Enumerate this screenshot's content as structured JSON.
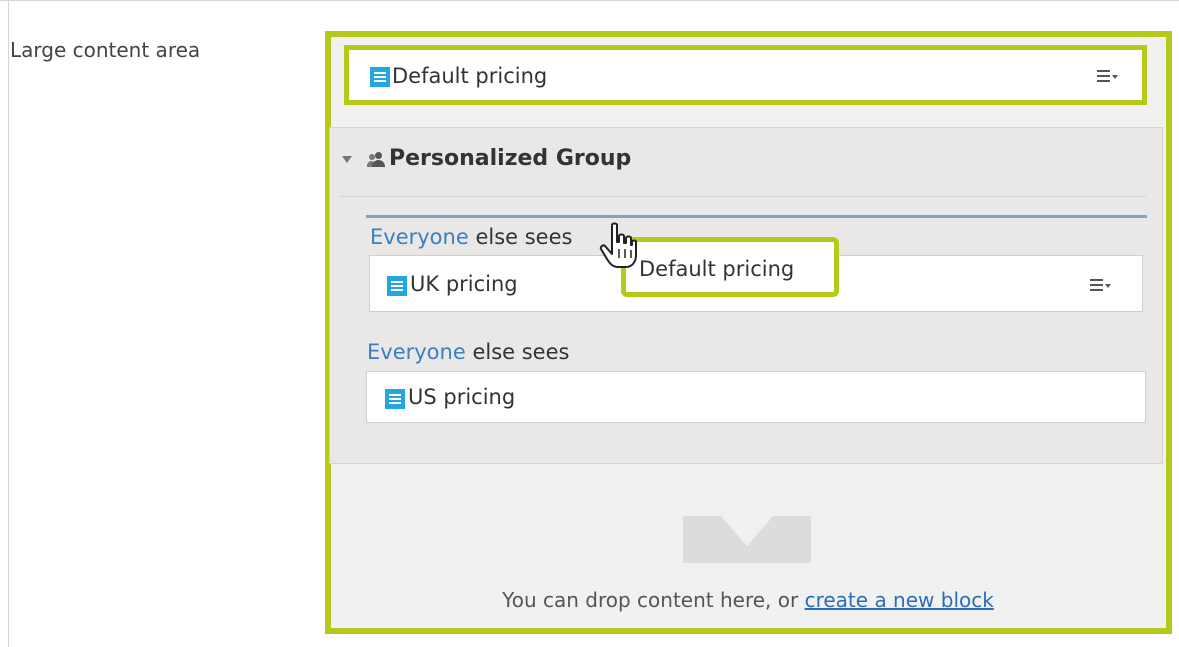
{
  "area": {
    "label": "Large content area"
  },
  "blocks": {
    "default": "Default pricing",
    "uk": "UK pricing",
    "us": "US pricing"
  },
  "group": {
    "title": "Personalized Group"
  },
  "audience": {
    "row1": {
      "link": "Everyone",
      "rest": " else sees"
    },
    "row2": {
      "link": "Everyone",
      "rest": " else sees"
    }
  },
  "tooltip": {
    "text": "Default pricing"
  },
  "drop_zone": {
    "hint": "You can drop content here, or ",
    "link": "create a new block"
  },
  "colors": {
    "highlight": "#b5c91a",
    "doc_icon": "#24a6e5",
    "link": "#3a7fc4"
  },
  "icons": [
    "document-icon",
    "context-menu-icon",
    "collapse-arrow-icon",
    "users-icon",
    "drop-arrow-icon",
    "hand-cursor-icon"
  ]
}
